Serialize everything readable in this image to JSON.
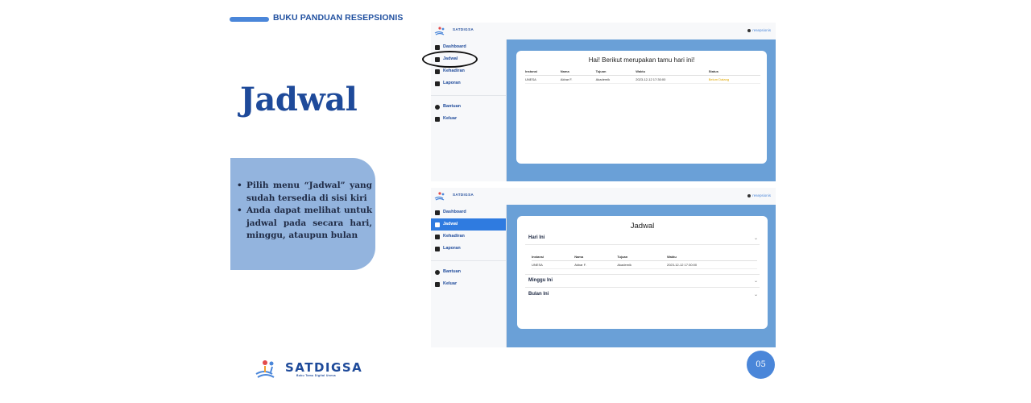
{
  "header": {
    "title": "BUKU PANDUAN RESEPSIONIS"
  },
  "page_title": "Jadwal",
  "instructions": [
    "Pilih menu “Jadwal” yang sudah tersedia di sisi kiri",
    "Anda dapat melihat untuk jadwal pada secara hari, minggu, ataupun bulan"
  ],
  "logo": {
    "name": "SATDIGSA",
    "tagline": "Buku Tamu Digital Unesa"
  },
  "page_number": "05",
  "app": {
    "logo_text": "SATDIGSA",
    "user": "resepsionis",
    "nav": [
      {
        "label": "Dashboard",
        "icon": "dashboard-icon"
      },
      {
        "label": "Jadwal",
        "icon": "calendar-icon"
      },
      {
        "label": "Kehadiran",
        "icon": "person-icon"
      },
      {
        "label": "Laporan",
        "icon": "document-icon"
      }
    ],
    "nav_bottom": [
      {
        "label": "Bantuan",
        "icon": "help-icon"
      },
      {
        "label": "Keluar",
        "icon": "logout-icon"
      }
    ]
  },
  "screenshot1": {
    "card_title": "Hai! Berikut merupakan tamu hari ini!",
    "columns": [
      "Instansi",
      "Nama",
      "Tujuan",
      "Waktu",
      "Status"
    ],
    "rows": [
      {
        "instansi": "UNESA",
        "nama": "Akbar F.",
        "tujuan": "Akademik",
        "waktu": "2023-12-12 17:30:00",
        "status": "Belum Datang"
      }
    ]
  },
  "screenshot2": {
    "card_title": "Jadwal",
    "sections": [
      {
        "label": "Hari Ini",
        "expanded": true
      },
      {
        "label": "Minggu Ini",
        "expanded": false
      },
      {
        "label": "Bulan Ini",
        "expanded": false
      }
    ],
    "columns": [
      "Instansi",
      "Nama",
      "Tujuan",
      "Waktu"
    ],
    "rows": [
      {
        "instansi": "UNESA",
        "nama": "Akbar F.",
        "tujuan": "Akademik",
        "waktu": "2023-12-12 17:30:00"
      }
    ]
  },
  "colors": {
    "accent": "#4a86d9",
    "title_blue": "#1e4a9a",
    "info_box": "#93b4de",
    "app_main": "#6aa0d7",
    "active_nav": "#2f7be0"
  }
}
